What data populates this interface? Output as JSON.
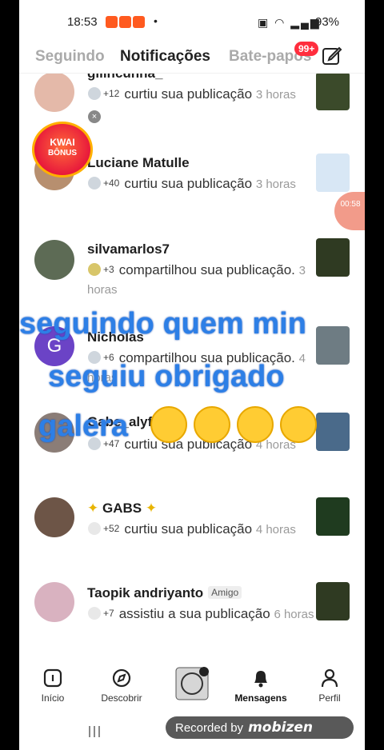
{
  "status_bar": {
    "time": "18:53",
    "battery": "93%",
    "dot": "•"
  },
  "tabs": [
    {
      "label": "Seguindo",
      "active": false
    },
    {
      "label": "Notificações",
      "active": true
    },
    {
      "label": "Bate-papos",
      "active": false
    }
  ],
  "badge": "99+",
  "kwai": {
    "line1": "KWAI",
    "line2": "BÔNUS",
    "close": "×"
  },
  "float_timer": "00:58",
  "notifications": [
    {
      "name": "giiihcunha_",
      "count": "+12",
      "action": "curtiu sua publicação",
      "time": "3 horas"
    },
    {
      "name": "Luciane Matulle",
      "count": "+40",
      "action": "curtiu sua publicação",
      "time": "3 horas"
    },
    {
      "name": "silvamarlos7",
      "count": "+3",
      "action": "compartilhou sua publicação.",
      "time": "3 horas"
    },
    {
      "name": "Nicholas",
      "avatar_letter": "G",
      "count": "+6",
      "action": "compartilhou sua publicação.",
      "time": "4 horas"
    },
    {
      "name": "Gabe_alyf",
      "count": "+47",
      "action": "curtiu sua publicação",
      "time": "4 horas"
    },
    {
      "name": "GABS",
      "count": "+52",
      "action": "curtiu sua publicação",
      "time": "4 horas"
    },
    {
      "name": "Taopik andriyanto",
      "tag": "Amigo",
      "count": "+7",
      "action": "assistiu a sua publicação",
      "time": "6 horas"
    }
  ],
  "overlay_text": {
    "line1": "seguindo quem min",
    "line2": "seguiu obrigado",
    "line3": "galera"
  },
  "nav": [
    {
      "label": "Início",
      "icon": "home-icon"
    },
    {
      "label": "Descobrir",
      "icon": "compass-icon"
    },
    {
      "label": "",
      "icon": "profile-badge-icon"
    },
    {
      "label": "Mensagens",
      "icon": "bell-icon",
      "active": true
    },
    {
      "label": "Perfil",
      "icon": "person-icon"
    }
  ],
  "recorder": {
    "prefix": "Recorded by",
    "brand": "mobizen"
  },
  "colors": {
    "accent_red": "#ff2d3d",
    "overlay_blue": "#2d7fe6",
    "avatar_purple": "#6b43c6"
  }
}
